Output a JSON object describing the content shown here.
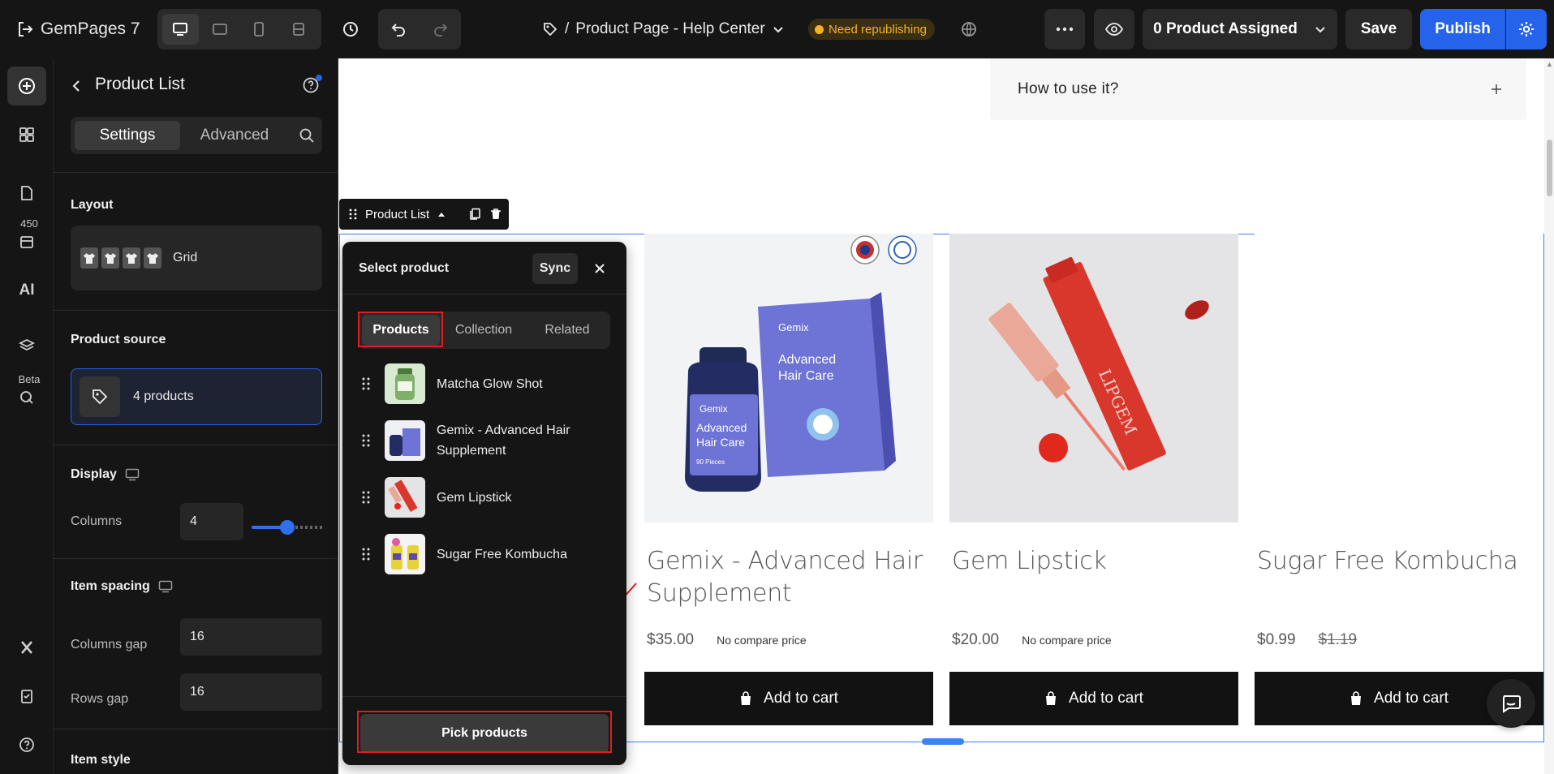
{
  "topbar": {
    "app_name": "GemPages 7",
    "page_prefix": "/",
    "page_name": "Product Page - Help Center",
    "status_badge": "Need republishing",
    "assigned_label": "0 Product Assigned",
    "save_label": "Save",
    "publish_label": "Publish"
  },
  "rail": {
    "badge_count": "450",
    "ai_label": "AI",
    "beta_label": "Beta"
  },
  "panel": {
    "title": "Product List",
    "tabs": [
      "Settings",
      "Advanced"
    ],
    "layout_label": "Layout",
    "layout_value": "Grid",
    "source_label": "Product source",
    "source_value": "4 products",
    "display_label": "Display",
    "columns_label": "Columns",
    "columns_value": "4",
    "columns_slider_fraction": 0.5,
    "spacing_label": "Item spacing",
    "columns_gap_label": "Columns gap",
    "columns_gap_value": "16",
    "rows_gap_label": "Rows gap",
    "rows_gap_value": "16",
    "item_style_label": "Item style"
  },
  "canvas": {
    "faq_question": "How to use it?",
    "element_label": "Product List",
    "products": [
      {
        "title": "Gemix - Advanced Hair Supplement",
        "price": "$35.00",
        "compare": "No compare price",
        "compare_strike": false,
        "button": "Add to cart"
      },
      {
        "title": "Gem Lipstick",
        "price": "$20.00",
        "compare": "No compare price",
        "compare_strike": false,
        "button": "Add to cart"
      },
      {
        "title": "Sugar Free Kombucha",
        "price": "$0.99",
        "compare": "$1.19",
        "compare_strike": true,
        "button": "Add to cart"
      }
    ],
    "bottle_brand": "Gemix",
    "bottle_text": "Advanced Hair Care",
    "bottle_sub": "90 Pieces",
    "lipstick_brand": "LIPGEM"
  },
  "popup": {
    "title": "Select product",
    "sync_label": "Sync",
    "tabs": [
      "Products",
      "Collection",
      "Related"
    ],
    "items": [
      {
        "name": "Matcha Glow Shot"
      },
      {
        "name": "Gemix - Advanced Hair Supplement"
      },
      {
        "name": "Gem Lipstick"
      },
      {
        "name": "Sugar Free Kombucha"
      }
    ],
    "pick_label": "Pick products"
  },
  "colors": {
    "accent_blue": "#2563eb",
    "warning": "#f5b324",
    "highlight_red": "#e11d1d"
  }
}
